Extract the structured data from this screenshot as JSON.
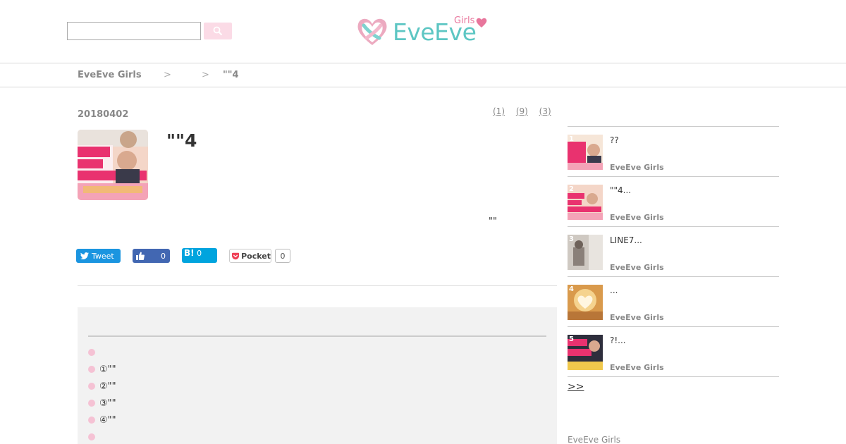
{
  "header": {
    "search_placeholder": "",
    "logo_text": "EveEve",
    "logo_girls": "Girls"
  },
  "breadcrumb": {
    "items": [
      "EveEve Girls",
      "",
      "\"\"4"
    ],
    "separator": ">"
  },
  "article": {
    "date": "20180402",
    "stats": [
      "(1)",
      "(9)",
      "(3)"
    ],
    "title": "\"\"4",
    "body_quote": "\"\""
  },
  "social": {
    "tweet": "Tweet",
    "like_count": "0",
    "hatena_label": "B!",
    "hatena_count": "0",
    "pocket": "Pocket",
    "pocket_count": "0"
  },
  "toc": {
    "items": [
      "",
      "①\"\"",
      "②\"\"",
      "③\"\"",
      "④\"\"",
      ""
    ]
  },
  "sidebar": {
    "items": [
      {
        "rank": "1",
        "title": "??",
        "site": "EveEve Girls"
      },
      {
        "rank": "2",
        "title": "\"\"4...",
        "site": "EveEve Girls"
      },
      {
        "rank": "3",
        "title": "LINE7...",
        "site": "EveEve Girls"
      },
      {
        "rank": "4",
        "title": "...",
        "site": "EveEve Girls"
      },
      {
        "rank": "5",
        "title": "?!...",
        "site": "EveEve Girls"
      }
    ],
    "more": ">>",
    "footer_site": "EveEve Girls"
  },
  "colors": {
    "brand_teal": "#5dc6c3",
    "brand_pink": "#e8769c",
    "tweet": "#1b95e0",
    "facebook": "#4267b2",
    "hatena": "#00a4de",
    "pocket": "#ef4056"
  }
}
